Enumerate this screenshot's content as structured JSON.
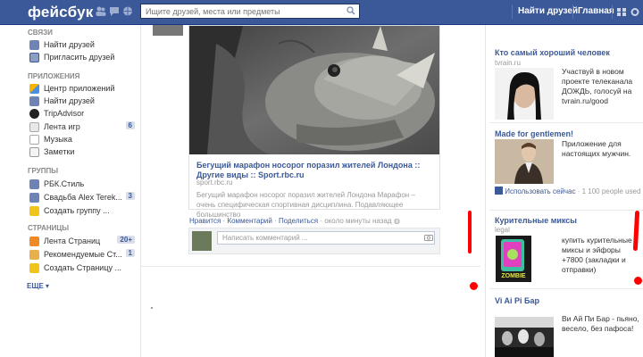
{
  "topbar": {
    "logo": "фейсбук",
    "search_placeholder": "Ищите друзей, места или предметы",
    "find_friends": "Найти друзей",
    "home": "Главная",
    "bg_color": "#3b5998"
  },
  "sidebar": {
    "sections": [
      {
        "title": "СВЯЗИ",
        "items": [
          {
            "label": "Найти друзей",
            "icon": "find-friends-icon",
            "count": ""
          },
          {
            "label": "Пригласить друзей",
            "icon": "invite-icon",
            "count": ""
          }
        ]
      },
      {
        "title": "ПРИЛОЖЕНИЯ",
        "items": [
          {
            "label": "Центр приложений",
            "icon": "app-center-icon",
            "count": ""
          },
          {
            "label": "Найти друзей",
            "icon": "find-friends-icon",
            "count": ""
          },
          {
            "label": "TripAdvisor",
            "icon": "tripadvisor-icon",
            "count": ""
          },
          {
            "label": "Лента игр",
            "icon": "games-icon",
            "count": "6"
          },
          {
            "label": "Музыка",
            "icon": "music-icon",
            "count": ""
          },
          {
            "label": "Заметки",
            "icon": "notes-icon",
            "count": ""
          }
        ]
      },
      {
        "title": "ГРУППЫ",
        "items": [
          {
            "label": "РБК.Стиль",
            "icon": "group-icon",
            "count": ""
          },
          {
            "label": "Свадьба Alex Terek...",
            "icon": "group-icon",
            "count": "3"
          },
          {
            "label": "Создать группу ...",
            "icon": "create-group-icon",
            "count": ""
          }
        ]
      },
      {
        "title": "СТРАНИЦЫ",
        "items": [
          {
            "label": "Лента Страниц",
            "icon": "pages-feed-icon",
            "count": "20+"
          },
          {
            "label": "Рекомендуемые Ст...",
            "icon": "recommended-pages-icon",
            "count": "1"
          },
          {
            "label": "Создать Страницу ...",
            "icon": "create-page-icon",
            "count": ""
          }
        ]
      }
    ],
    "more": "ЕЩЕ"
  },
  "post": {
    "link_title": "Бегущий марафон носорог поразил жителей Лондона :: Другие виды :: Sport.rbc.ru",
    "domain": "sport.rbc.ru",
    "description": "Бегущий марафон носорог поразил жителей Лондона Марафон – очень специфическая спортивная дисциплина. Подавляющее большинство",
    "like": "Нравится",
    "comment": "Комментарий",
    "share": "Поделиться",
    "time": "около минуты назад",
    "comment_placeholder": "Написать комментарий ..."
  },
  "ads": [
    {
      "title": "Кто самый хороший человек",
      "domain": "tvrain.ru",
      "text": "Участвуй в новом проекте телеканала ДОЖДЬ, голосуй на tvrain.ru/good"
    },
    {
      "title": "Made for gentlemen!",
      "domain": "",
      "text": "Приложение для настоящих мужчин.",
      "use_now": "Использовать сейчас",
      "users": "1 100 people used"
    },
    {
      "title": "Курительные миксы",
      "domain": "legal",
      "text": "купить курительные миксы и эйфоры +7800 (закладки и отправки)",
      "img_label": "ZOMBIE"
    },
    {
      "title": "Vi Ai Pi Бар",
      "domain": "",
      "text": "Ви Ай Пи Бар - пьяно, весело, без пафоса!"
    }
  ],
  "annotation_color": "#ff0000"
}
